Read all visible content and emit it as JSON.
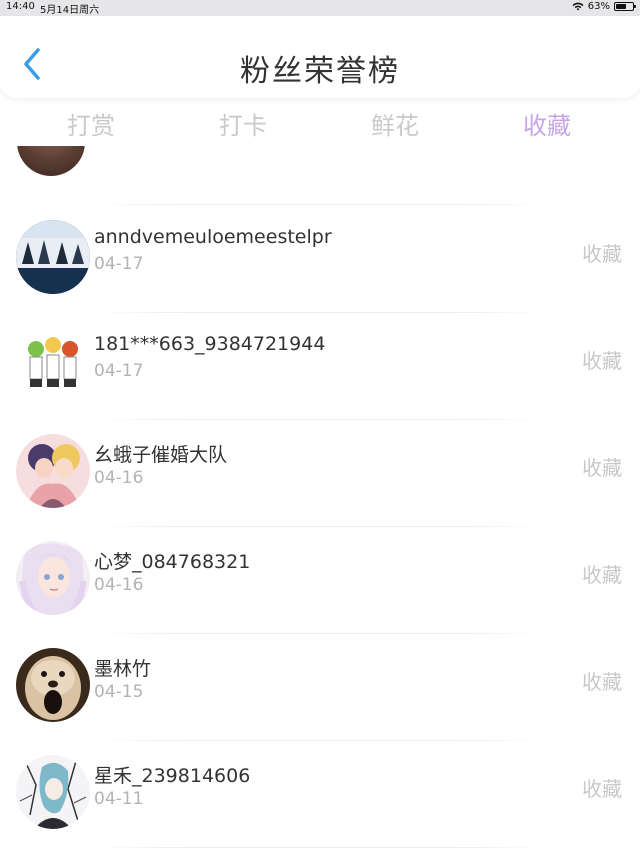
{
  "status_bar": {
    "time": "14:40",
    "date": "5月14日周六",
    "battery": "63%",
    "battery_level": 0.63,
    "wifi_icon": "wifi-icon"
  },
  "nav": {
    "title": "粉丝荣誉榜",
    "back_icon": "chevron-left-icon",
    "accent_color": "#3a9de8"
  },
  "tabs": [
    {
      "label": "打赏",
      "active": false
    },
    {
      "label": "打卡",
      "active": false
    },
    {
      "label": "鲜花",
      "active": false
    },
    {
      "label": "收藏",
      "active": true
    }
  ],
  "colors": {
    "active_tab": "#c8a6e6",
    "inactive_tab": "#c9c9c9"
  },
  "fans": [
    {
      "name": "anndvemeuloemeestelpr",
      "date": "04-17",
      "tag": "收藏"
    },
    {
      "name": "181***663_9384721944",
      "date": "04-17",
      "tag": "收藏"
    },
    {
      "name": "幺蛾子催婚大队",
      "date": "04-16",
      "tag": "收藏"
    },
    {
      "name": "心梦_084768321",
      "date": "04-16",
      "tag": "收藏"
    },
    {
      "name": "墨林竹",
      "date": "04-15",
      "tag": "收藏"
    },
    {
      "name": "星禾_239814606",
      "date": "04-11",
      "tag": "收藏"
    }
  ]
}
